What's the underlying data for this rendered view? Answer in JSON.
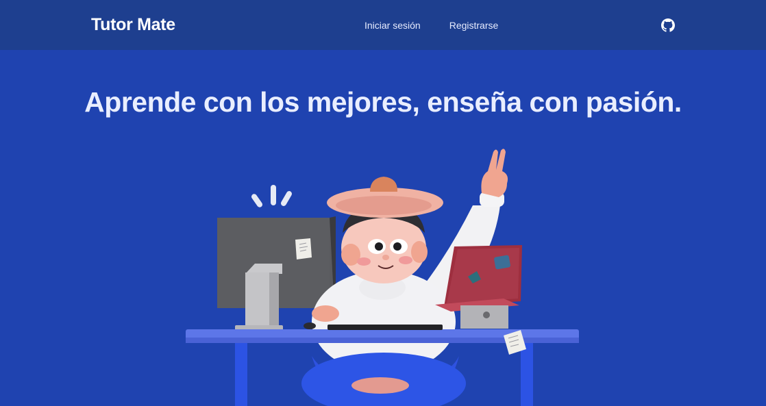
{
  "nav": {
    "brand": "Tutor Mate",
    "login_label": "Iniciar sesión",
    "register_label": "Registrarse",
    "github_icon": "github-icon"
  },
  "hero": {
    "title": "Aprende con los mejores, enseña con pasión.",
    "illustration": "person-at-desk-illustration"
  },
  "colors": {
    "navbar": "#1e3f8f",
    "background": "#1f43b0",
    "text": "#ffffff"
  }
}
